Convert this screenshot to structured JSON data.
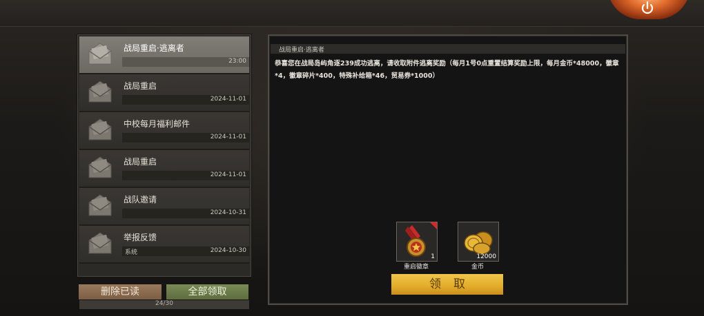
{
  "header": {
    "power_icon": "power-icon"
  },
  "mail_list": {
    "items": [
      {
        "title": "战局重启·逃离者",
        "sender": "",
        "date": "23:00",
        "selected": true
      },
      {
        "title": "战局重启",
        "sender": "",
        "date": "2024-11-01",
        "selected": false
      },
      {
        "title": "中校每月福利邮件",
        "sender": "",
        "date": "2024-11-01",
        "selected": false
      },
      {
        "title": "战局重启",
        "sender": "",
        "date": "2024-11-01",
        "selected": false
      },
      {
        "title": "战队邀请",
        "sender": "",
        "date": "2024-10-31",
        "selected": false
      },
      {
        "title": "举报反馈",
        "sender": "系统",
        "date": "2024-10-30",
        "selected": false
      }
    ],
    "count": "24/30"
  },
  "actions": {
    "delete_read": "删除已读",
    "claim_all": "全部领取"
  },
  "detail": {
    "title": "战局重启·逃离者",
    "body": "恭喜您在战局岛屿角逐239成功逃离，请收取附件逃离奖励（每月1号0点重置结算奖励上限，每月金币*48000，徽章*4，徽章碎片*400，特殊补给箱*46，贸易券*1000）",
    "rewards": [
      {
        "name": "重启徽章",
        "qty": "1",
        "icon": "medal-icon"
      },
      {
        "name": "金币",
        "qty": "12000",
        "icon": "gold-coins-icon"
      }
    ],
    "claim_label": "领取"
  },
  "colors": {
    "claim_button": "#e8b83a",
    "delete_button": "#8a6a4e",
    "claim_all_button": "#6a7a48",
    "new_badge": "#d62828"
  }
}
